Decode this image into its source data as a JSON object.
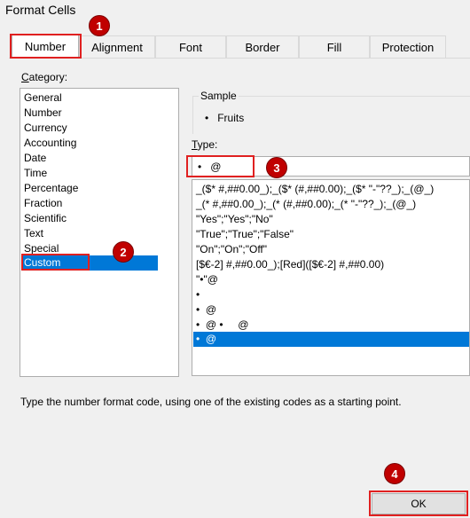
{
  "window": {
    "title": "Format Cells"
  },
  "tabs": [
    {
      "label": "Number"
    },
    {
      "label": "Alignment"
    },
    {
      "label": "Font"
    },
    {
      "label": "Border"
    },
    {
      "label": "Fill"
    },
    {
      "label": "Protection"
    }
  ],
  "category": {
    "label": "Category:",
    "items": [
      "General",
      "Number",
      "Currency",
      "Accounting",
      "Date",
      "Time",
      "Percentage",
      "Fraction",
      "Scientific",
      "Text",
      "Special",
      "Custom"
    ],
    "selected": "Custom"
  },
  "sample": {
    "label": "Sample",
    "value": "•   Fruits"
  },
  "type": {
    "label": "Type:",
    "value": "•   @",
    "formats": [
      "_($* #,##0.00_);_($* (#,##0.00);_($* \"-\"??_);_(@_)",
      "_(* #,##0.00_);_(* (#,##0.00);_(* \"-\"??_);_(@_)",
      "\"Yes\";\"Yes\";\"No\"",
      "\"True\";\"True\";\"False\"",
      "\"On\";\"On\";\"Off\"",
      "[$€-2] #,##0.00_);[Red]([$€-2] #,##0.00)",
      "\"•\"@",
      "•",
      "•  @",
      "•  @ •     @",
      "•  @"
    ],
    "selected_index": 10
  },
  "hint": "Type the number format code, using one of the existing codes as a starting point.",
  "buttons": {
    "ok": "OK"
  },
  "badges": [
    "1",
    "2",
    "3",
    "4"
  ]
}
